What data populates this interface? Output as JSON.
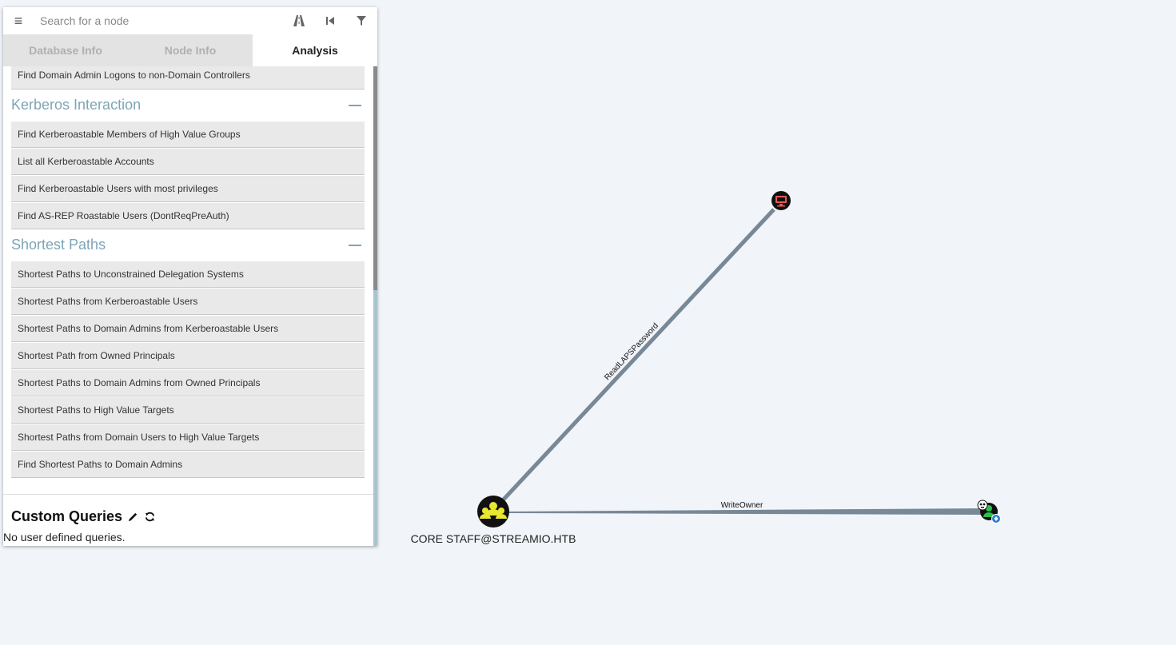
{
  "search": {
    "placeholder": "Search for a node"
  },
  "icons": {
    "menu": "hamburger-icon",
    "pathfinding": "road-icon",
    "back": "back-icon",
    "filter": "filter-icon",
    "edit": "pencil-icon",
    "refresh": "refresh-icon"
  },
  "tabs": [
    {
      "label": "Database Info",
      "active": false
    },
    {
      "label": "Node Info",
      "active": false
    },
    {
      "label": "Analysis",
      "active": true
    }
  ],
  "analysis": {
    "top_item": "Find Domain Admin Logons to non-Domain Controllers",
    "sections": [
      {
        "title": "Kerberos Interaction",
        "items": [
          "Find Kerberoastable Members of High Value Groups",
          "List all Kerberoastable Accounts",
          "Find Kerberoastable Users with most privileges",
          "Find AS-REP Roastable Users (DontReqPreAuth)"
        ]
      },
      {
        "title": "Shortest Paths",
        "items": [
          "Shortest Paths to Unconstrained Delegation Systems",
          "Shortest Paths from Kerberoastable Users",
          "Shortest Paths to Domain Admins from Kerberoastable Users",
          "Shortest Path from Owned Principals",
          "Shortest Paths to Domain Admins from Owned Principals",
          "Shortest Paths to High Value Targets",
          "Shortest Paths from Domain Users to High Value Targets",
          "Find Shortest Paths to Domain Admins"
        ]
      }
    ]
  },
  "custom_queries": {
    "title": "Custom Queries",
    "empty_text": "No user defined queries."
  },
  "graph": {
    "nodes": {
      "group": {
        "label": "CORE STAFF@STREAMIO.HTB",
        "color": "#e8e831",
        "type": "group-icon"
      },
      "computer": {
        "label": "",
        "color": "#e25b5b",
        "type": "computer-icon"
      },
      "user": {
        "label": "",
        "color": "#29c24a",
        "type": "user-icon"
      }
    },
    "edges": {
      "readlaps": "ReadLAPSPassword",
      "writeowner": "WriteOwner"
    },
    "edge_color": "#778897"
  }
}
